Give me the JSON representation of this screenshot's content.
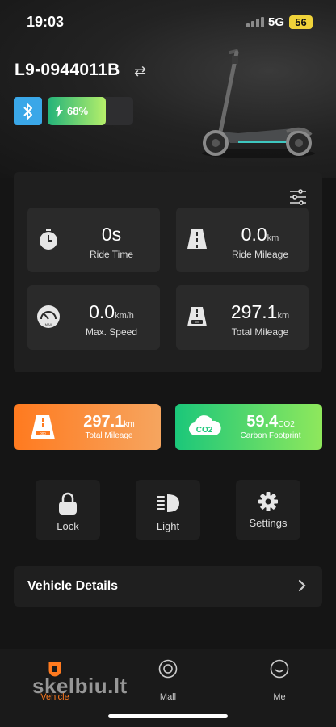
{
  "status": {
    "time": "19:03",
    "network": "5G",
    "battery": "56"
  },
  "vehicle": {
    "name": "L9-0944011B",
    "battery_percent_label": "68%",
    "battery_level": 0.68
  },
  "stats": [
    {
      "value": "0",
      "unit": "s",
      "label": "Ride Time",
      "icon": "stopwatch-icon"
    },
    {
      "value": "0.0",
      "unit": "km",
      "label": "Ride Mileage",
      "icon": "road-icon"
    },
    {
      "value": "0.0",
      "unit": "km/h",
      "label": "Max. Speed",
      "icon": "speedometer-icon"
    },
    {
      "value": "297.1",
      "unit": "km",
      "label": "Total Mileage",
      "icon": "road-odometer-icon"
    }
  ],
  "summary": {
    "mileage": {
      "value": "297.1",
      "unit": "km",
      "label": "Total Mileage"
    },
    "carbon": {
      "value": "59.4",
      "unit": "CO2",
      "label": "Carbon Footprint",
      "badge": "CO2"
    }
  },
  "controls": {
    "lock": "Lock",
    "light": "Light",
    "settings": "Settings"
  },
  "details": {
    "label": "Vehicle Details"
  },
  "tabs": {
    "vehicle": "Vehicle",
    "mall": "Mall",
    "me": "Me"
  },
  "watermark": "skelbiu.lt",
  "colors": {
    "accent": "#ff7a1f",
    "green": "#1bc77a",
    "bluetooth": "#3aa7e8",
    "badge": "#f0d33a"
  }
}
